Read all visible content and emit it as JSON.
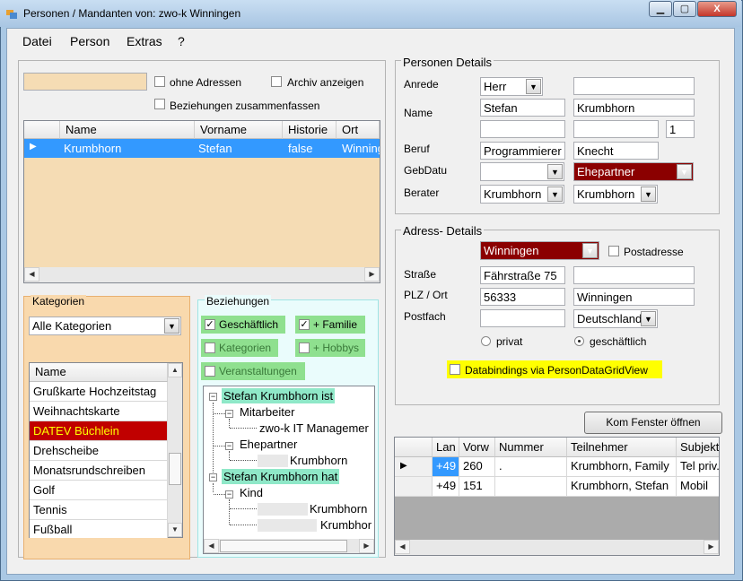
{
  "window": {
    "title": "Personen / Mandanten von: zwo-k Winningen",
    "min": "▁",
    "max": "▢",
    "close": "X"
  },
  "menu": [
    "Datei",
    "Person",
    "Extras",
    "?"
  ],
  "search": {
    "value": "",
    "chk_no_address": "ohne Adressen",
    "chk_archive": "Archiv anzeigen",
    "chk_combine": "Beziehungen zusammenfassen"
  },
  "grid": {
    "headers": [
      "Name",
      "Vorname",
      "Historie",
      "Ort"
    ],
    "rows": [
      {
        "name": "Krumbhorn",
        "vorname": "Stefan",
        "historie": "false",
        "ort": "Winningen"
      }
    ]
  },
  "kategorien": {
    "title": "Kategorien",
    "filter": "Alle Kategorien",
    "header": "Name",
    "items": [
      "Grußkarte Hochzeitstag",
      "Weihnachtskarte",
      "DATEV Büchlein",
      "Drehscheibe",
      "Monatsrundschreiben",
      "Golf",
      "Tennis",
      "Fußball"
    ],
    "selected_index": 2
  },
  "beziehungen": {
    "title": "Beziehungen",
    "tags": [
      {
        "label": "Geschäftlich",
        "checked": true
      },
      {
        "label": "+ Familie",
        "checked": true
      },
      {
        "label": "Kategorien",
        "checked": false
      },
      {
        "label": "+ Hobbys",
        "checked": false
      },
      {
        "label": "Veranstaltungen",
        "checked": false
      }
    ],
    "tree": {
      "n1": "Stefan Krumbhorn ist",
      "n1a": "Mitarbeiter",
      "n1a1": "zwo-k  IT Managemer",
      "n1b": "Ehepartner",
      "n1b1": "Krumbhorn",
      "n2": "Stefan Krumbhorn hat",
      "n2a": "Kind",
      "n2a1": "Krumbhorn",
      "n2a2": "Krumbhor"
    },
    "hscroll": "III"
  },
  "details": {
    "title": "Personen Details",
    "labels": {
      "anrede": "Anrede",
      "name": "Name",
      "beruf": "Beruf",
      "gebdatu": "GebDatu",
      "berater": "Berater"
    },
    "anrede": "Herr",
    "anrede2": "",
    "vorname": "Stefan",
    "nachname": "Krumbhorn",
    "name3": "",
    "name4": "",
    "nr": "1",
    "beruf": "Programmierer",
    "beruf2": "Knecht",
    "gebdat": "",
    "rel": "Ehepartner",
    "berater1": "Krumbhorn",
    "berater2": "Krumbhorn"
  },
  "adresse": {
    "title": "Adress- Details",
    "ort_combo": "Winningen",
    "chk_postadresse": "Postadresse",
    "labels": {
      "strasse": "Straße",
      "plzort": "PLZ / Ort",
      "postfach": "Postfach"
    },
    "strasse": "Fährstraße 75",
    "strasse2": "",
    "plz": "56333",
    "ort": "Winningen",
    "postfach": "",
    "land": "Deutschland",
    "radio_privat": "privat",
    "radio_geschaeftlich": "geschäftlich",
    "databindings": "Databindings via PersonDataGridView"
  },
  "kom": {
    "button": "Kom Fenster öffnen",
    "headers": [
      "Lan",
      "Vorw",
      "Nummer",
      "Teilnehmer",
      "Subjekt"
    ],
    "rows": [
      {
        "lan": "+49",
        "vorw": "260",
        "nummer": ".",
        "teilnehmer": "Krumbhorn, Family",
        "subjekt": "Tel priv."
      },
      {
        "lan": "+49",
        "vorw": "151",
        "nummer": "",
        "teilnehmer": "Krumbhorn, Stefan",
        "subjekt": "Mobil"
      }
    ]
  }
}
